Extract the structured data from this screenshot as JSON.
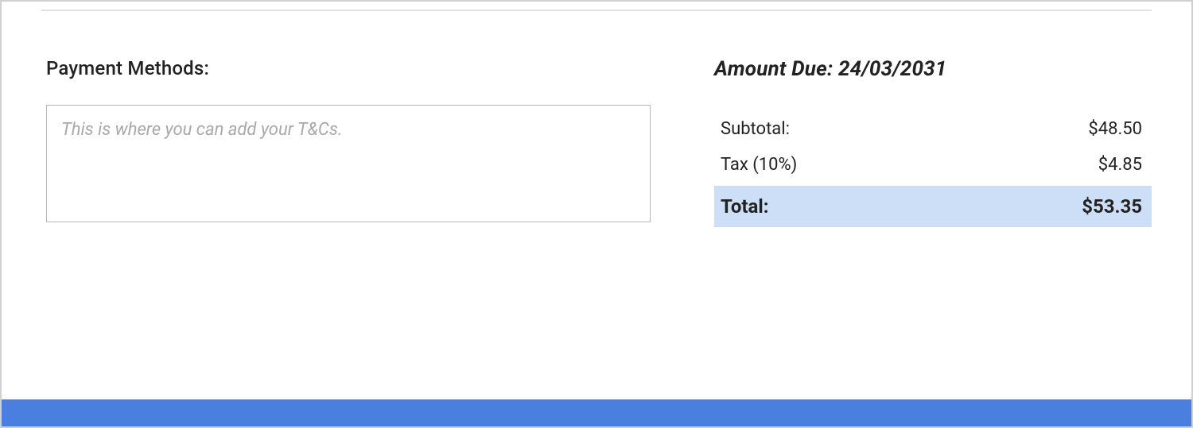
{
  "left": {
    "heading": "Payment Methods:",
    "terms_placeholder": "This is where you can add your T&Cs."
  },
  "right": {
    "amount_due_heading": "Amount Due: 24/03/2031",
    "subtotal_label": "Subtotal:",
    "subtotal_value": "$48.50",
    "tax_label": "Tax (10%)",
    "tax_value": "$4.85",
    "total_label": "Total:",
    "total_value": "$53.35"
  }
}
